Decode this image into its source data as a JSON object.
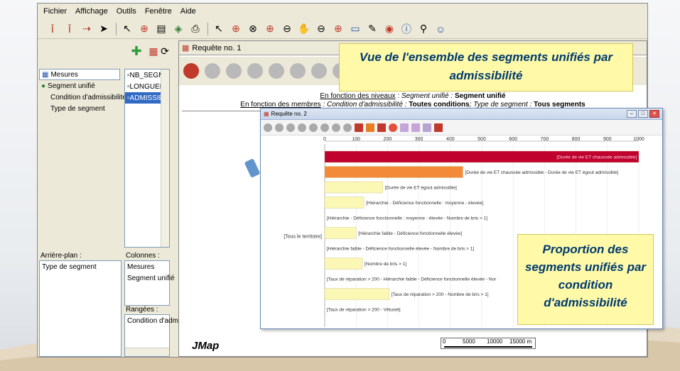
{
  "menu": [
    "Fichier",
    "Affichage",
    "Outils",
    "Fenêtre",
    "Aide"
  ],
  "left": {
    "tree": [
      {
        "label": "Mesures",
        "icon": "grid-icon",
        "selected": true
      },
      {
        "label": "Segment unifié",
        "icon": "globe-icon",
        "selected": false
      },
      {
        "label": "Condition d'admissibilité",
        "icon": "",
        "selected": false
      },
      {
        "label": "Type de segment",
        "icon": "",
        "selected": false
      }
    ],
    "fields": [
      "NB_SEGM",
      "LONGUEL",
      "ADMISSIE"
    ],
    "background_label": "Arrière-plan :",
    "background_value": "Type de segment",
    "columns_label": "Colonnes :",
    "columns_values": [
      "Mesures",
      "Segment unifié"
    ],
    "rows_label": "Rangées :",
    "rows_value": "Condition d'admi"
  },
  "query1": {
    "title": "Requête no. 1",
    "levels_prefix": "En fonction des niveaux",
    "levels_text": " : Segment unifié : ",
    "levels_bold": "Segment unifié",
    "members_prefix": "En fonction des membres",
    "members_text1": " : Condition d'admissibilité : ",
    "members_bold1": "Toutes conditions",
    "members_text2": "; Type de segment : ",
    "members_bold2": "Tous segments"
  },
  "callout_top": "Vue de l'ensemble des segments unifiés par admissibilité",
  "callout_bottom": "Proportion des segments unifiés par condition d'admissibilité",
  "query2": {
    "title": "Requête no. 2"
  },
  "row_label": "[Tous le territoire]",
  "jmap": "JMap",
  "scale": {
    "ticks": [
      "0",
      "5000",
      "10000",
      "15000 m"
    ]
  },
  "colors": {
    "bar_red": "#c0002d",
    "bar_orange": "#f28a3a",
    "bar_yellow": "#fbf7b4",
    "callout_bg": "#fff9a8",
    "callout_text": "#003b6f"
  },
  "chart_data": {
    "type": "bar",
    "orientation": "horizontal",
    "xlim": [
      0,
      1000
    ],
    "xticks": [
      0,
      100,
      200,
      300,
      400,
      500,
      600,
      700,
      800,
      900,
      1000
    ],
    "bars": [
      {
        "label": "[Durée de vie ET chaussée admissible]",
        "value": 1000,
        "color": "#c0002d"
      },
      {
        "label": "[Durée de vie ET chaussée admissible - Durée de vie ET égout admissible]",
        "value": 440,
        "color": "#f28a3a"
      },
      {
        "label": "[Durée de vie ET égout admissible]",
        "value": 185,
        "color": "#fbf7b4"
      },
      {
        "label": "[Hiérarchie - Déficience fonctionnelle : moyenne - élevée]",
        "value": 125,
        "color": "#fbf7b4"
      },
      {
        "label": "[Hiérarchie - Déficience fonctionnelle : moyenne - élevée - Nombre de bris > 1]",
        "value": 0,
        "color": "#fbf7b4"
      },
      {
        "label": "[Hiérarchie faible - Déficience fonctionnelle élevée]",
        "value": 100,
        "color": "#fbf7b4"
      },
      {
        "label": "[Hiérarchie faible - Déficience fonctionnelle élevée - Nombre de bris > 1]",
        "value": 0,
        "color": "#fbf7b4"
      },
      {
        "label": "[Nombre de bris > 1]",
        "value": 120,
        "color": "#fbf7b4"
      },
      {
        "label": "[Taux de réparation > 200 - Hiérarchie faible - Déficience fonctionnelle élevée - Nor",
        "value": 0,
        "color": "#fbf7b4"
      },
      {
        "label": "[Taux de réparation > 200 - Nombre de bris > 1]",
        "value": 205,
        "color": "#fbf7b4"
      },
      {
        "label": "[Taux de réparation > 200 - Vétusté]",
        "value": 0,
        "color": "#fbf7b4"
      }
    ]
  }
}
